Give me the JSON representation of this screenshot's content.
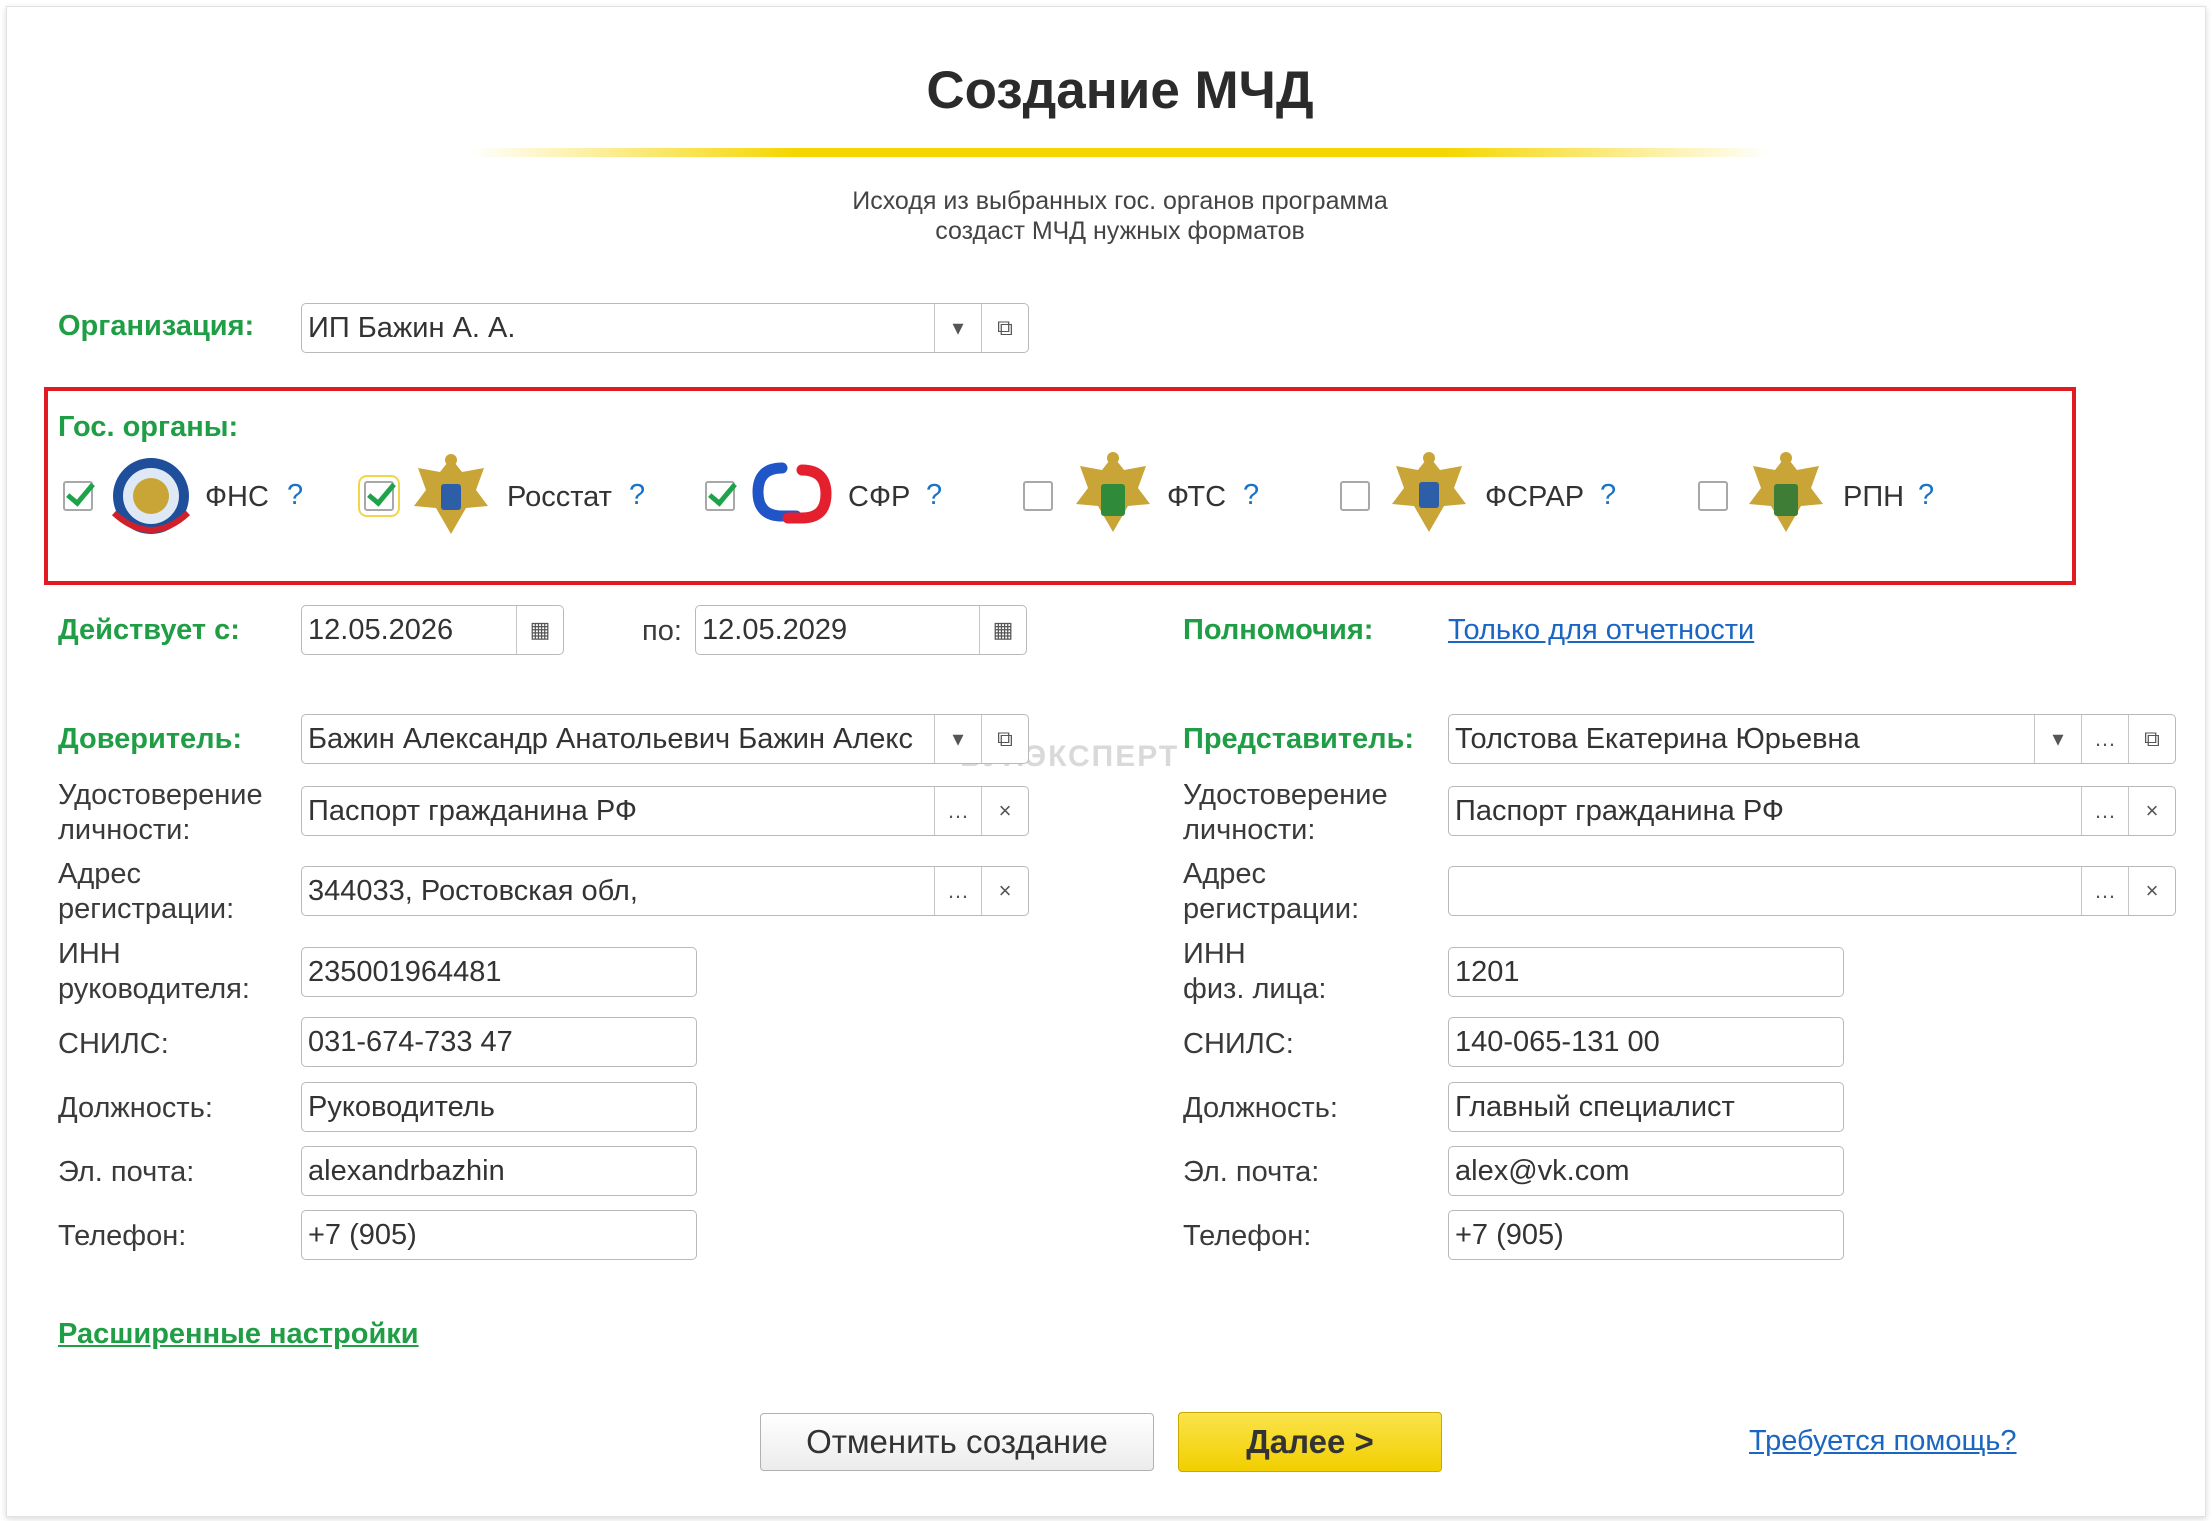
{
  "title": "Создание МЧД",
  "subtitle_line1": "Исходя из выбранных гос. органов программа",
  "subtitle_line2": "создаст МЧД нужных форматов",
  "organization": {
    "label": "Организация:",
    "value": "ИП Бажин А. А."
  },
  "agencies": {
    "label": "Гос. органы:",
    "help": "?",
    "items": [
      {
        "name": "ФНС",
        "checked": true
      },
      {
        "name": "Росстат",
        "checked": true
      },
      {
        "name": "СФР",
        "checked": true
      },
      {
        "name": "ФТС",
        "checked": false
      },
      {
        "name": "ФСРАР",
        "checked": false
      },
      {
        "name": "РПН",
        "checked": false
      }
    ]
  },
  "validity": {
    "label": "Действует с:",
    "from": "12.05.2026",
    "to_label": "по:",
    "to": "12.05.2029"
  },
  "powers": {
    "label": "Полномочия:",
    "value": "Только для отчетности"
  },
  "principal": {
    "label": "Доверитель:",
    "name": "Бажин Александр Анатольевич Бажин Алекс",
    "id_label_1": "Удостоверение",
    "id_label_2": "личности:",
    "id_value": "Паспорт гражданина РФ",
    "addr_label_1": "Адрес",
    "addr_label_2": "регистрации:",
    "addr_value": "344033, Ростовская обл,",
    "inn_label_1": "ИНН",
    "inn_label_2": "руководителя:",
    "inn_value": "235001964481",
    "snils_label": "СНИЛС:",
    "snils_value": "031-674-733 47",
    "position_label": "Должность:",
    "position_value": "Руководитель",
    "email_label": "Эл. почта:",
    "email_value": "alexandrbazhin",
    "phone_label": "Телефон:",
    "phone_value": "+7 (905)"
  },
  "representative": {
    "label": "Представитель:",
    "name": "Толстова Екатерина Юрьевна",
    "id_label_1": "Удостоверение",
    "id_label_2": "личности:",
    "id_value": "Паспорт гражданина РФ",
    "addr_label_1": "Адрес",
    "addr_label_2": "регистрации:",
    "addr_value": "",
    "inn_label_1": "ИНН",
    "inn_label_2": "физ. лица:",
    "inn_value": "1201",
    "snils_label": "СНИЛС:",
    "snils_value": "140-065-131 00",
    "position_label": "Должность:",
    "position_value": "Главный специалист",
    "email_label": "Эл. почта:",
    "email_value": "alex@vk.com",
    "phone_label": "Телефон:",
    "phone_value": "+7 (905)"
  },
  "advanced_settings": "Расширенные настройки",
  "buttons": {
    "cancel": "Отменить создание",
    "next": "Далее >"
  },
  "help_link": "Требуется помощь?",
  "watermark": "БУХЭКСПЕРТ",
  "colors": {
    "label_green": "#1f9e45",
    "highlight_red": "#e21b23",
    "accent_yellow": "#f6d600",
    "link_blue": "#1a66c2"
  }
}
